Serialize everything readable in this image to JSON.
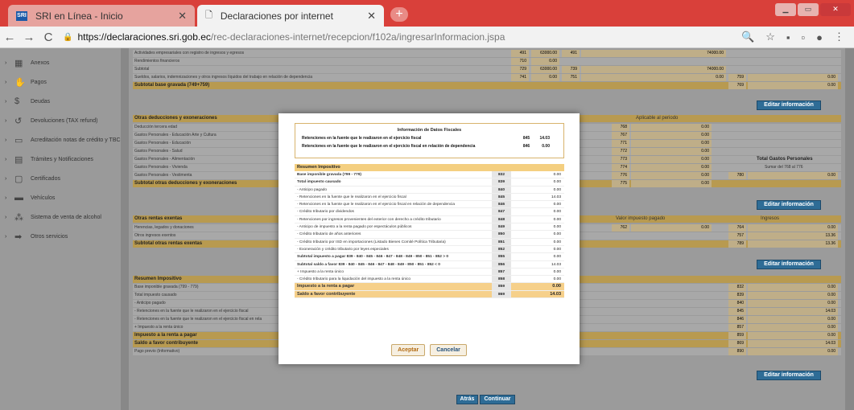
{
  "browser": {
    "tabs": [
      {
        "label": "SRI en Línea - Inicio",
        "favicon": "SRI"
      },
      {
        "label": "Declaraciones por internet"
      }
    ],
    "url_host": "https://declaraciones.sri.gob.ec",
    "url_path": "/rec-declaraciones-internet/recepcion/f102a/ingresarInformacion.jspa"
  },
  "sidebar": {
    "items": [
      {
        "label": "Anexos",
        "icon": "building-icon"
      },
      {
        "label": "Pagos",
        "icon": "handshake-icon"
      },
      {
        "label": "Deudas",
        "icon": "dollar-icon"
      },
      {
        "label": "Devoluciones (TAX refund)",
        "icon": "refund-icon"
      },
      {
        "label": "Acreditación notas de crédito y TBC",
        "icon": "card-icon"
      },
      {
        "label": "Trámites y Notificaciones",
        "icon": "folder-icon"
      },
      {
        "label": "Certificados",
        "icon": "certificate-icon"
      },
      {
        "label": "Vehículos",
        "icon": "car-icon"
      },
      {
        "label": "Sistema de venta de alcohol",
        "icon": "bottle-icon"
      },
      {
        "label": "Otros servicios",
        "icon": "arrow-icon"
      }
    ]
  },
  "background": {
    "rows_top": [
      {
        "label": "Actividades empresariales con registro de ingresos y egresos",
        "code": "491",
        "val": "63000.00",
        "code2": "491",
        "val2": "74000.00"
      },
      {
        "label": "Rendimientos financieros",
        "code": "710",
        "val": "0.00"
      },
      {
        "label": "Subtotal",
        "code": "729",
        "val": "63000.00",
        "code2": "739",
        "val2": "74000.00"
      },
      {
        "label": "Sueldos, salarios, indemnizaciones y otros ingresos líquidos del trabajo en relación de dependencia",
        "code": "741",
        "val": "0.00",
        "code2": "751",
        "val2": "0.00",
        "code3": "759",
        "val3": "0.00"
      }
    ],
    "subtotal_base": {
      "label": "Subtotal base gravada (749+759)",
      "code": "769",
      "val": "0.00"
    },
    "edit_label": "Editar información",
    "other_deductions_title": "Otras deducciones y exoneraciones",
    "aplicable_label": "Aplicable al periodo",
    "deduction_rows": [
      {
        "label": "Deducción tercera edad",
        "code": "768",
        "val": "0.00"
      },
      {
        "label": "Gastos Personales - Educación Arte y Cultura",
        "code": "767",
        "val": "0.00"
      },
      {
        "label": "Gastos Personales - Educación",
        "code": "771",
        "val": "0.00"
      },
      {
        "label": "Gastos Personales - Salud",
        "code": "772",
        "val": "0.00"
      },
      {
        "label": "Gastos Personales - Alimentación",
        "code": "773",
        "val": "0.00"
      },
      {
        "label": "Gastos Personales - Vivienda",
        "code": "774",
        "val": "0.00"
      },
      {
        "label": "Gastos Personales - Vestimenta",
        "code": "776",
        "val": "0.00",
        "code2": "780",
        "val2": "0.00"
      }
    ],
    "total_gastos_label": "Total Gastos Personales",
    "sumar_label": "Sumar del 768 al 776",
    "subtotal_other": {
      "label": "Subtotal otras deducciones y exoneraciones",
      "code": "775",
      "val": "0.00"
    },
    "exempt_title": "Otras rentas exentas",
    "valor_pagado_label": "Valor impuesto pagado",
    "ingresos_label": "Ingresos",
    "exempt_rows": [
      {
        "label": "Herencias, legados y donaciones",
        "code": "762",
        "val": "0.00",
        "code2": "764",
        "val2": "0.00"
      },
      {
        "label": "Otros ingresos exentos",
        "code2": "757",
        "val2": "13.36"
      }
    ],
    "subtotal_exempt": {
      "label": "Subtotal otras rentas exentas",
      "code": "789",
      "val": "13.36"
    },
    "summary_title": "Resumen Impositivo",
    "summary_rows": [
      {
        "label": "Base imponible gravada (799 - 779)",
        "code": "832",
        "val": "0.00"
      },
      {
        "label": "Total impuesto causado",
        "code": "839",
        "val": "0.00"
      },
      {
        "label": "- Anticipo pagado",
        "code": "840",
        "val": "0.00"
      },
      {
        "label": "- Retenciones en la fuente que le realizaron en el ejercicio fiscal",
        "code": "845",
        "val": "14.03"
      },
      {
        "label": "- Retenciones en la fuente que le realizaron en el ejercicio fiscal en rela",
        "code": "846",
        "val": "0.00"
      },
      {
        "label": "+ Impuesto a la renta único",
        "code": "857",
        "val": "0.00"
      },
      {
        "label": "Impuesto a la renta a pagar",
        "code": "859",
        "val": "0.00"
      },
      {
        "label": "Saldo a favor contribuyente",
        "code": "869",
        "val": "14.03"
      },
      {
        "label": "Pago previo (Informativo)",
        "code": "890",
        "val": "0.00"
      }
    ],
    "back_label": "Atrás",
    "continue_label": "Continuar"
  },
  "modal": {
    "info_title": "Información de Datos Fiscales",
    "info_rows": [
      {
        "label": "Retenciones en la fuente que le realizaron en el ejercicio fiscal",
        "code": "845",
        "val": "14.03"
      },
      {
        "label": "Retenciones en la fuente que le realizaron en el ejercicio fiscal en relación de dependencia",
        "code": "846",
        "val": "0.00"
      }
    ],
    "summary_header": "Resumen Impositivo",
    "rows": [
      {
        "label": "Base imponible gravada (799 - 779)",
        "code": "832",
        "val": "0.00",
        "bold": true
      },
      {
        "label": "Total impuesto causado",
        "code": "839",
        "val": "0.00",
        "bold": true
      },
      {
        "label": "- Anticipo pagado",
        "code": "840",
        "val": "0.00"
      },
      {
        "label": "- Retenciones en la fuente que le realizaron en el ejercicio fiscal",
        "code": "845",
        "val": "14.03"
      },
      {
        "label": "- Retenciones en la fuente que le realizaron en el ejercicio fiscal en relación de dependencia",
        "code": "846",
        "val": "0.00"
      },
      {
        "label": "- Crédito tributario por dividendos",
        "code": "847",
        "val": "0.00"
      },
      {
        "label": "- Retenciones por ingresos provenientes del exterior con derecho a crédito tributario",
        "code": "848",
        "val": "0.00"
      },
      {
        "label": "- Anticipo de impuesto a la renta pagado por espectáculos públicos",
        "code": "849",
        "val": "0.00"
      },
      {
        "label": "- Crédito tributario de años anteriores",
        "code": "850",
        "val": "0.00"
      },
      {
        "label": "- Crédito tributario por ISD en importaciones (Listado Bienes Comité Política Tributaria)",
        "code": "851",
        "val": "0.00"
      },
      {
        "label": "- Exoneración y crédito tributario por leyes especiales",
        "code": "852",
        "val": "0.00"
      },
      {
        "label": "Subtotal impuesto a pagar     839 - 840 - 845 - 846 - 847 - 848 - 849 - 850 - 851 - 852 > 0",
        "code": "855",
        "val": "0.00",
        "bold": true
      },
      {
        "label": "Subtotal saldo a favor     839 - 840 - 845 - 846 - 847 - 848 - 849 - 850 - 851 - 852 < 0",
        "code": "856",
        "val": "14.03",
        "bold": true
      },
      {
        "label": "+ Impuesto a la renta único",
        "code": "857",
        "val": "0.00"
      },
      {
        "label": "- Crédito tributario para la liquidación del impuesto a la renta único",
        "code": "858",
        "val": "0.00"
      },
      {
        "label": "Impuesto a la renta a pagar",
        "code": "859",
        "val": "0.00",
        "highlight": true
      },
      {
        "label": "Saldo a favor contribuyente",
        "code": "869",
        "val": "14.03",
        "highlight": true
      }
    ],
    "accept_label": "Aceptar",
    "cancel_label": "Cancelar"
  }
}
